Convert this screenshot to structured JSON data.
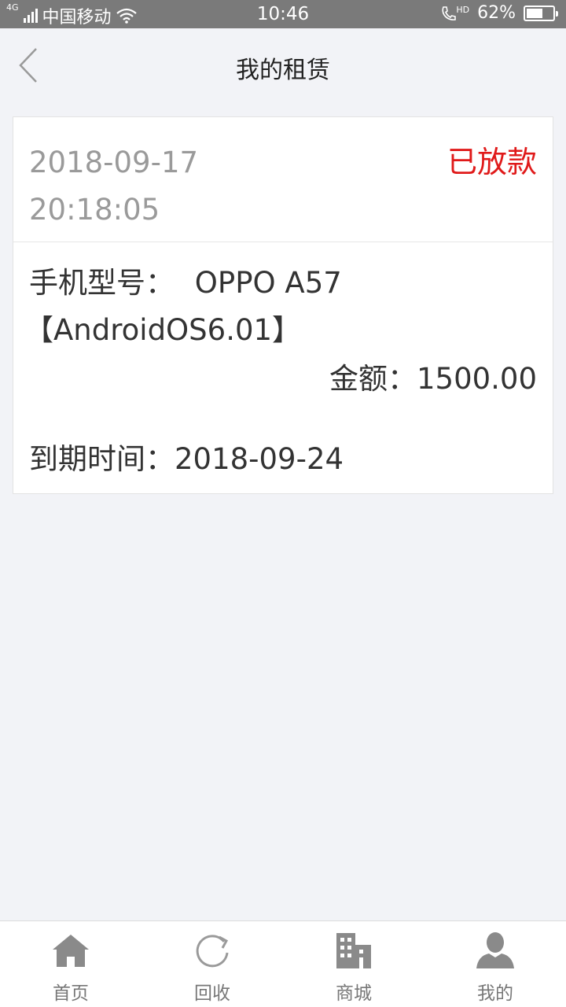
{
  "status_bar": {
    "network": "4G",
    "carrier": "中国移动",
    "time": "10:46",
    "hd_label": "HD",
    "battery": "62%",
    "battery_level": 0.62
  },
  "header": {
    "title": "我的租赁"
  },
  "order": {
    "date": "2018-09-17",
    "time": "20:18:05",
    "status": "已放款",
    "status_color": "#e01a1a",
    "model_label": "手机型号：",
    "model_value": "OPPO A57",
    "os_value": "【AndroidOS6.01】",
    "amount_label": "金额：",
    "amount_value": "1500.00",
    "expiry_label": "到期时间：",
    "expiry_value": "2018-09-24"
  },
  "bottom_nav": {
    "items": [
      {
        "label": "首页",
        "icon": "home-icon"
      },
      {
        "label": "回收",
        "icon": "refresh-icon"
      },
      {
        "label": "商城",
        "icon": "building-icon"
      },
      {
        "label": "我的",
        "icon": "user-icon"
      }
    ]
  }
}
